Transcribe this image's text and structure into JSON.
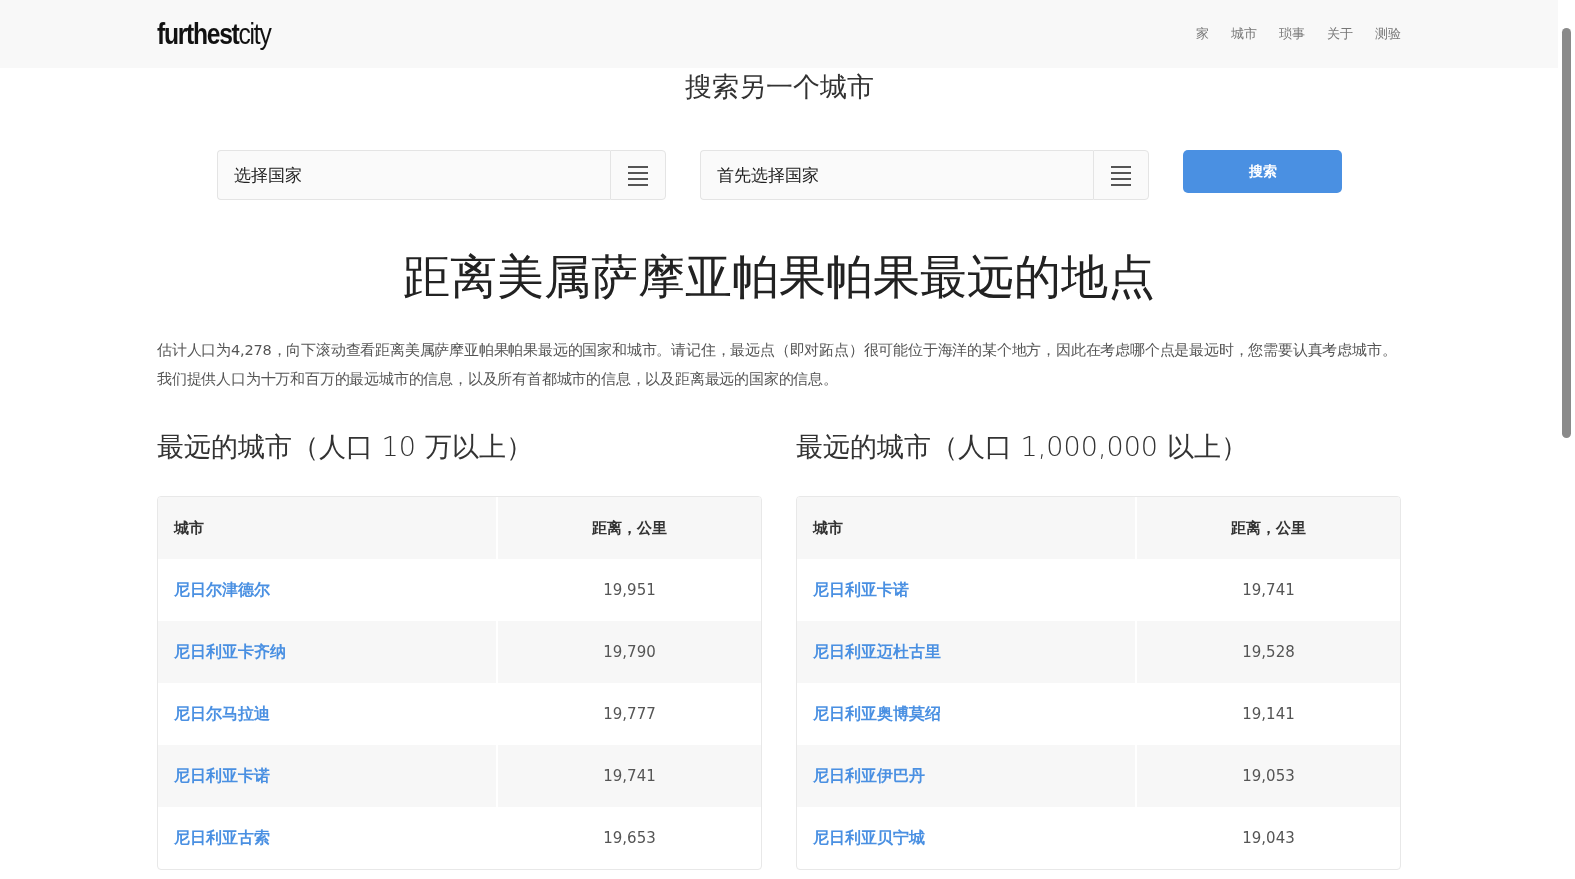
{
  "header": {
    "logo": "**furthest**city",
    "nav": [
      "家",
      "城市",
      "琐事",
      "关于",
      "测验"
    ]
  },
  "search": {
    "title": "搜索另一个城市",
    "country_field": {
      "placeholder": "选择国家"
    },
    "city_field": {
      "placeholder": "首先选择国家"
    },
    "button": "搜索"
  },
  "headline": "距离美属萨摩亚帕果帕果最远的地点",
  "intro": "估计人口为4,278，向下滚动查看距离美属萨摩亚帕果帕果最远的国家和城市。请记住，最远点（即对跖点）很可能位于海洋的某个地方，因此在考虑哪个点是最远时，您需要认真考虑城市。我们提供人口为十万和百万的最远城市的信息，以及所有首都城市的信息，以及距离最远的国家的信息。",
  "tables": [
    {
      "title": "最远的城市（人口 10 万以上）",
      "columns": [
        "城市",
        "距离，公里"
      ],
      "rows": [
        {
          "city": "尼日尔津德尔",
          "distance": "19,951"
        },
        {
          "city": "尼日利亚卡齐纳",
          "distance": "19,790"
        },
        {
          "city": "尼日尔马拉迪",
          "distance": "19,777"
        },
        {
          "city": "尼日利亚卡诺",
          "distance": "19,741"
        },
        {
          "city": "尼日利亚古索",
          "distance": "19,653"
        }
      ]
    },
    {
      "title": "最远的城市（人口 1,000,000 以上）",
      "columns": [
        "城市",
        "距离，公里"
      ],
      "rows": [
        {
          "city": "尼日利亚卡诺",
          "distance": "19,741"
        },
        {
          "city": "尼日利亚迈杜古里",
          "distance": "19,528"
        },
        {
          "city": "尼日利亚奥博莫绍",
          "distance": "19,141"
        },
        {
          "city": "尼日利亚伊巴丹",
          "distance": "19,053"
        },
        {
          "city": "尼日利亚贝宁城",
          "distance": "19,043"
        }
      ]
    }
  ]
}
